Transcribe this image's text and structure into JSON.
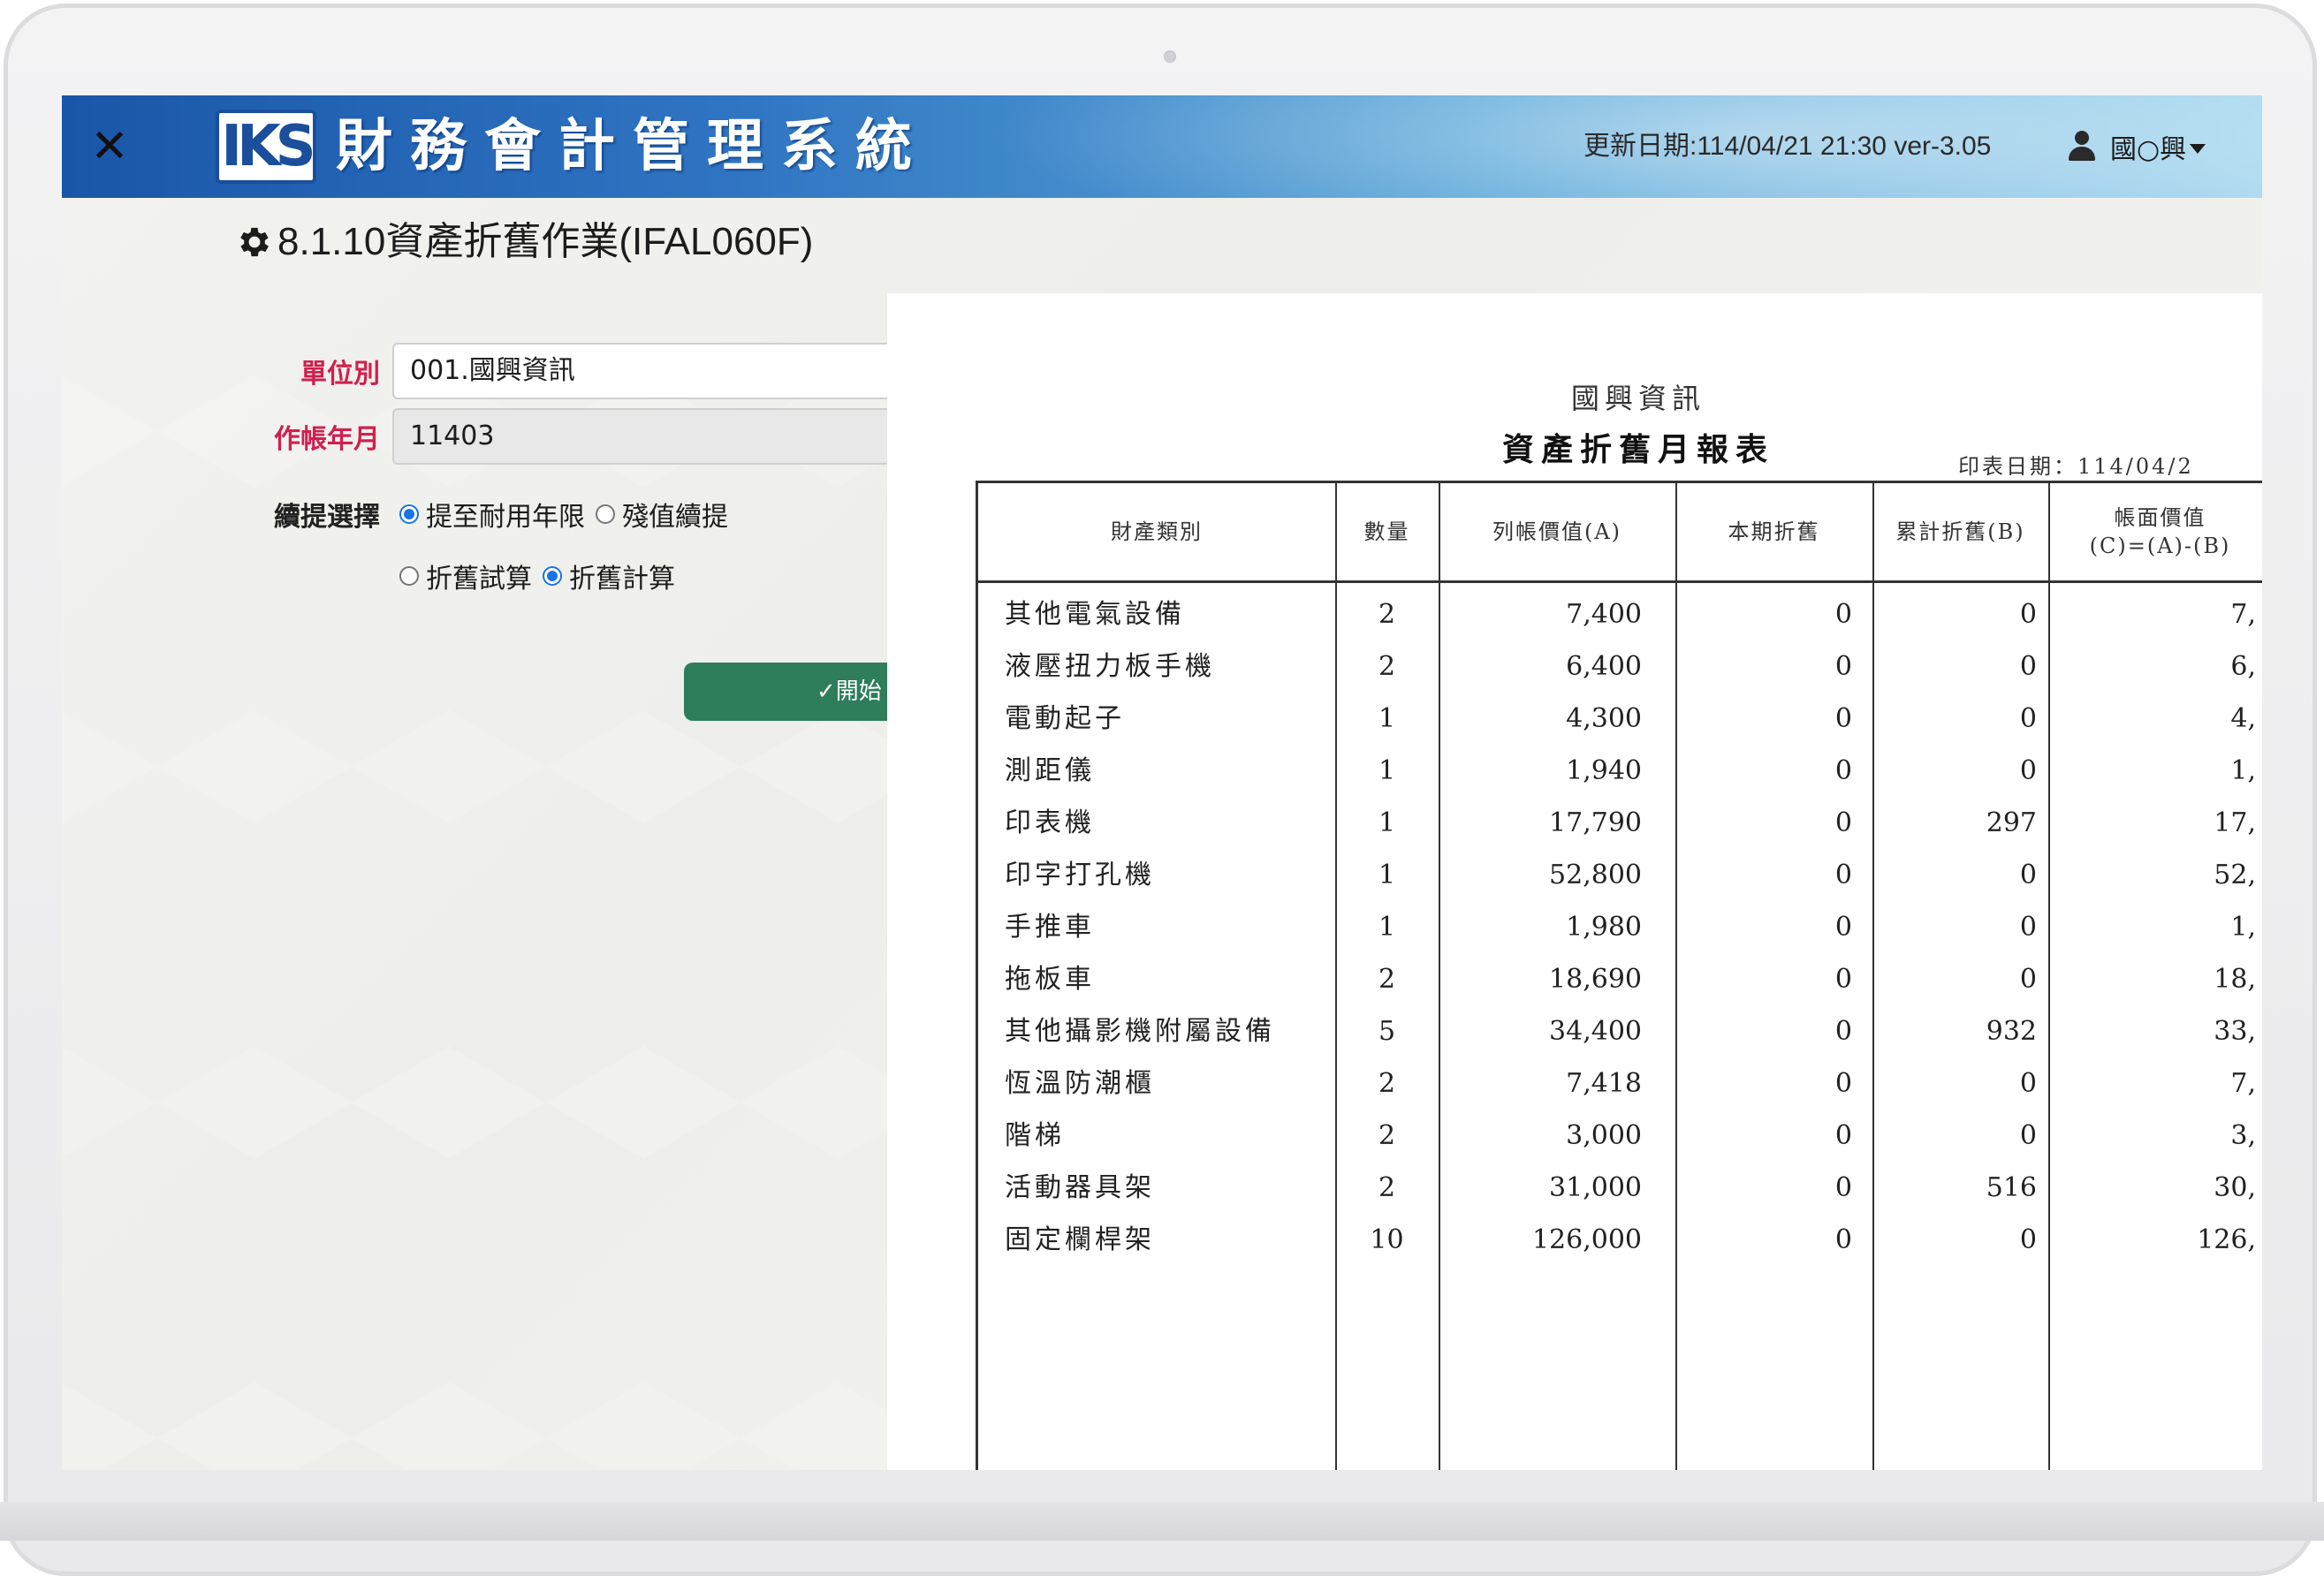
{
  "header": {
    "close_icon": "close-icon",
    "logo_text": "IKS",
    "title": "財務會計管理系統",
    "update_info": "更新日期:114/04/21 21:30 ver-3.05",
    "user_name": "國○興"
  },
  "page": {
    "title": "8.1.10資產折舊作業(IFAL060F)"
  },
  "form": {
    "unit_label": "單位別",
    "unit_value": "001.國興資訊",
    "period_label": "作帳年月",
    "period_value": "11403",
    "continue_label": "續提選擇",
    "continue_options": [
      {
        "label": "提至耐用年限",
        "checked": true
      },
      {
        "label": "殘值續提",
        "checked": false
      }
    ],
    "mode_options": [
      {
        "label": "折舊試算",
        "checked": false
      },
      {
        "label": "折舊計算",
        "checked": true
      }
    ],
    "start_button": "✓開始"
  },
  "report": {
    "company": "國興資訊",
    "title": "資產折舊月報表",
    "print_date": "印表日期：114/04/2",
    "columns": [
      "財產類別",
      "數量",
      "列帳價值(A)",
      "本期折舊",
      "累計折舊(B)",
      "帳面價值\n(C)=(A)-(B)"
    ],
    "rows": [
      {
        "name": "其他電氣設備",
        "qty": "2",
        "cost": "7,400",
        "current": "0",
        "accum": "0",
        "book": "7,"
      },
      {
        "name": "液壓扭力板手機",
        "qty": "2",
        "cost": "6,400",
        "current": "0",
        "accum": "0",
        "book": "6,"
      },
      {
        "name": "電動起子",
        "qty": "1",
        "cost": "4,300",
        "current": "0",
        "accum": "0",
        "book": "4,"
      },
      {
        "name": "測距儀",
        "qty": "1",
        "cost": "1,940",
        "current": "0",
        "accum": "0",
        "book": "1,"
      },
      {
        "name": "印表機",
        "qty": "1",
        "cost": "17,790",
        "current": "0",
        "accum": "297",
        "book": "17,"
      },
      {
        "name": "印字打孔機",
        "qty": "1",
        "cost": "52,800",
        "current": "0",
        "accum": "0",
        "book": "52,"
      },
      {
        "name": "手推車",
        "qty": "1",
        "cost": "1,980",
        "current": "0",
        "accum": "0",
        "book": "1,"
      },
      {
        "name": "拖板車",
        "qty": "2",
        "cost": "18,690",
        "current": "0",
        "accum": "0",
        "book": "18,"
      },
      {
        "name": "其他攝影機附屬設備",
        "qty": "5",
        "cost": "34,400",
        "current": "0",
        "accum": "932",
        "book": "33,"
      },
      {
        "name": "恆溫防潮櫃",
        "qty": "2",
        "cost": "7,418",
        "current": "0",
        "accum": "0",
        "book": "7,"
      },
      {
        "name": "階梯",
        "qty": "2",
        "cost": "3,000",
        "current": "0",
        "accum": "0",
        "book": "3,"
      },
      {
        "name": "活動器具架",
        "qty": "2",
        "cost": "31,000",
        "current": "0",
        "accum": "516",
        "book": "30,"
      },
      {
        "name": "固定欄桿架",
        "qty": "10",
        "cost": "126,000",
        "current": "0",
        "accum": "0",
        "book": "126,"
      }
    ]
  }
}
